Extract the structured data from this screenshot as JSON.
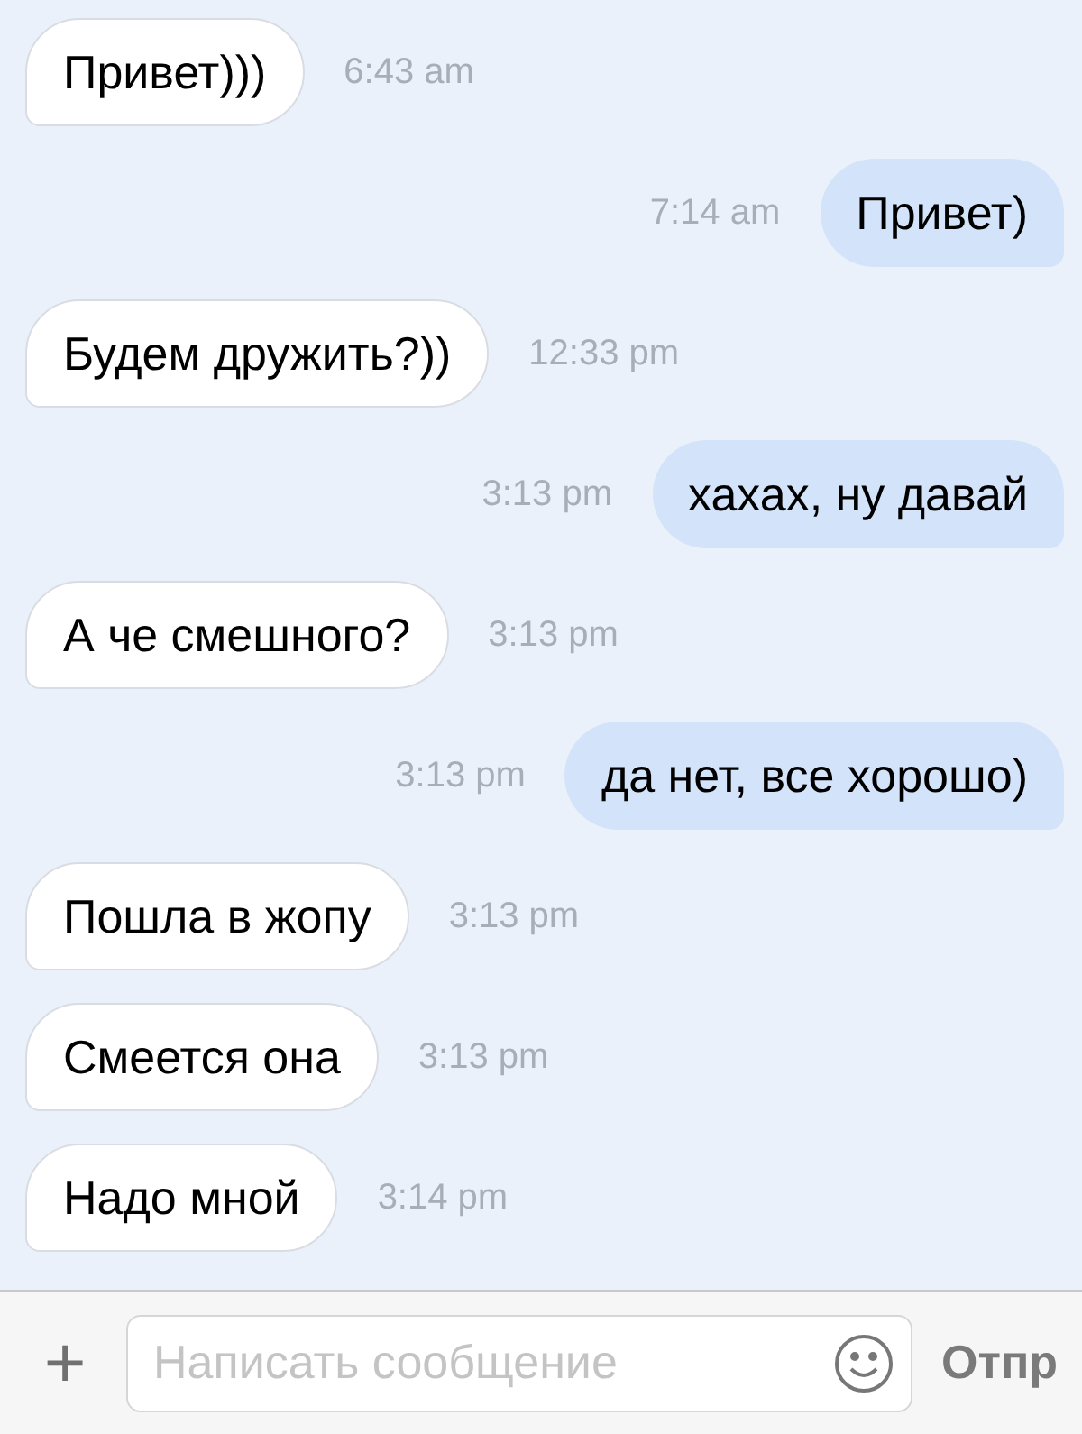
{
  "messages": [
    {
      "kind": "in",
      "text": "Привет)))",
      "time": "6:43 am"
    },
    {
      "kind": "out",
      "text": "Привет)",
      "time": "7:14 am"
    },
    {
      "kind": "in",
      "text": "Будем дружить?))",
      "time": "12:33 pm"
    },
    {
      "kind": "out",
      "text": "хахах, ну давай",
      "time": "3:13 pm"
    },
    {
      "kind": "in",
      "text": "А че смешного?",
      "time": "3:13 pm"
    },
    {
      "kind": "out",
      "text": "да нет, все хорошо)",
      "time": "3:13 pm"
    },
    {
      "kind": "in",
      "text": "Пошла в жопу",
      "time": "3:13 pm"
    },
    {
      "kind": "in",
      "text": "Смеется она",
      "time": "3:13 pm"
    },
    {
      "kind": "in",
      "text": "Надо мной",
      "time": "3:14 pm"
    }
  ],
  "composer": {
    "add": "+",
    "placeholder": "Написать сообщение",
    "send": "Отпр"
  }
}
